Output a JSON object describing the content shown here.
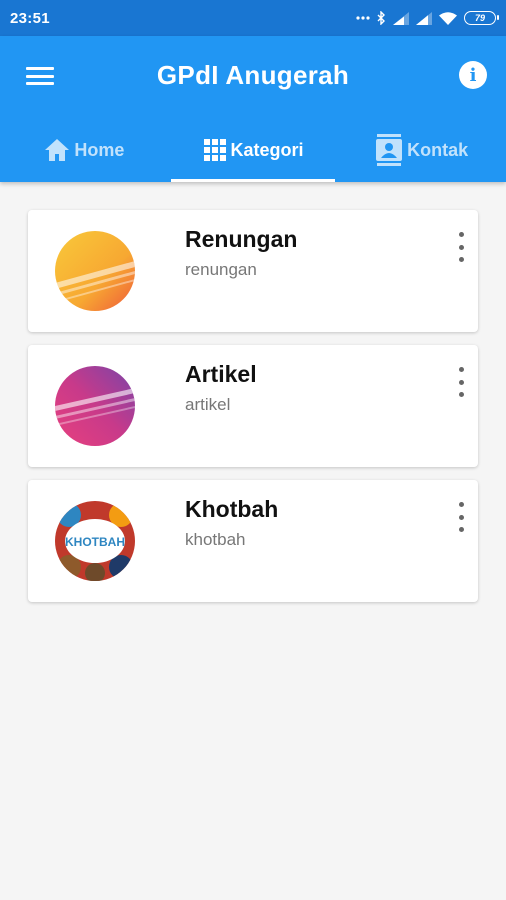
{
  "status_bar": {
    "time": "23:51",
    "battery": "79",
    "icons": [
      "dots-icon",
      "bluetooth-icon",
      "signal-icon",
      "signal-icon",
      "wifi-icon",
      "battery-icon"
    ]
  },
  "app_bar": {
    "title": "GPdI Anugerah",
    "menu_icon": "menu-icon",
    "info_icon": "info-icon"
  },
  "tabs": [
    {
      "label": "Home",
      "icon": "home-icon",
      "active": false
    },
    {
      "label": "Kategori",
      "icon": "grid-icon",
      "active": true
    },
    {
      "label": "Kontak",
      "icon": "contact-icon",
      "active": false
    }
  ],
  "categories": [
    {
      "title": "Renungan",
      "subtitle": "renungan",
      "thumb_colors": [
        "#f7b733",
        "#fc4a1a"
      ]
    },
    {
      "title": "Artikel",
      "subtitle": "artikel",
      "thumb_colors": [
        "#e0407b",
        "#8e44ad"
      ]
    },
    {
      "title": "Khotbah",
      "subtitle": "khotbah",
      "thumb_label": "KHOTBAH"
    }
  ],
  "colors": {
    "status_bar": "#1976d2",
    "primary": "#2196f3",
    "background": "#f5f5f5"
  }
}
